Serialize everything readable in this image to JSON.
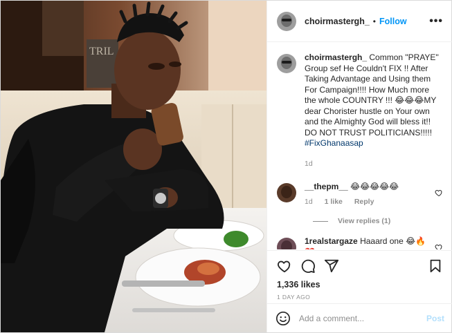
{
  "post": {
    "username": "choirmastergh_",
    "dot": "•",
    "follow_label": "Follow",
    "more_icon": "more-options-icon",
    "more_label": "•••"
  },
  "caption": {
    "username": "choirmastergh_",
    "text": "Common \"PRAYE\" Group sef He Couldn't FIX !! After Taking Advantage and Using them For Campaign!!!! How Much more the whole COUNTRY !!! 😂😂😂MY dear Chorister hustle on Your own and the Almighty God will bless it!! DO NOT TRUST POLITICIANS!!!!!",
    "hashtag": "#FixGhanaasap",
    "time": "1d"
  },
  "comments": [
    {
      "username": "__thepm__",
      "text": "😂😂😂😂😂",
      "time": "1d",
      "likes": "1 like",
      "reply_label": "Reply",
      "view_replies": "View replies (1)"
    },
    {
      "username": "1realstargaze",
      "text": "Haaard one 😂🔥❤️"
    }
  ],
  "actions": {
    "like_icon": "heart-icon",
    "comment_icon": "comment-icon",
    "share_icon": "share-icon",
    "save_icon": "bookmark-icon",
    "likes_count": "1,336 likes",
    "time_ago": "1 DAY AGO"
  },
  "add_comment": {
    "placeholder": "Add a comment...",
    "post_label": "Post",
    "emoji_icon": "emoji-icon"
  },
  "colors": {
    "accent": "#0095f6",
    "hashtag": "#00376b",
    "muted": "#8e8e8e",
    "post_disabled": "#b2dffc"
  }
}
